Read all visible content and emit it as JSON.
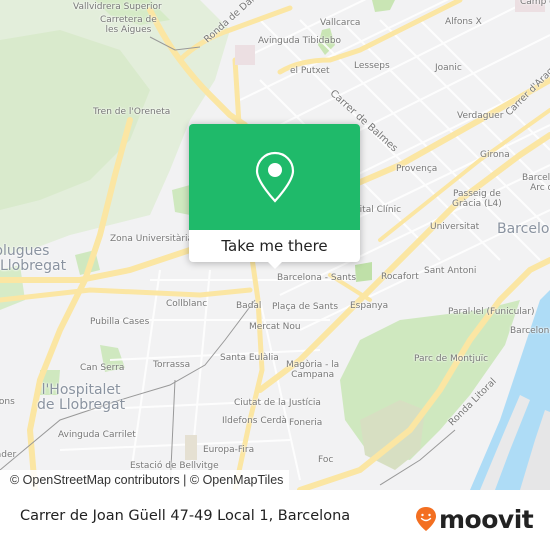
{
  "map": {
    "labels": [
      {
        "id": "vallvidrera-superior",
        "text": "Vallvidrera Superior"
      },
      {
        "id": "carretera-aigues",
        "text": "Carretera de\nles Aigues"
      },
      {
        "id": "ronda-de-dalt",
        "text": "Ronda de Dalt"
      },
      {
        "id": "avinguda-tibidabo",
        "text": "Avinguda Tibidabo"
      },
      {
        "id": "vallcarca",
        "text": "Vallcarca"
      },
      {
        "id": "alfons-x",
        "text": "Alfons X"
      },
      {
        "id": "camp",
        "text": "Camp d"
      },
      {
        "id": "el-putxet",
        "text": "el Putxet"
      },
      {
        "id": "lesseps",
        "text": "Lesseps"
      },
      {
        "id": "joanic",
        "text": "Joanic"
      },
      {
        "id": "carrer-de-balmes",
        "text": "Carrer de Balmes"
      },
      {
        "id": "carrer-arago",
        "text": "Carrer d'Aragó"
      },
      {
        "id": "tren-oreneta",
        "text": "Tren de l'Oreneta"
      },
      {
        "id": "verdaguer",
        "text": "Verdaguer"
      },
      {
        "id": "girona",
        "text": "Girona"
      },
      {
        "id": "provenca",
        "text": "Provença"
      },
      {
        "id": "barcelona-arc",
        "text": "Barcelona\nArc de"
      },
      {
        "id": "passeig-gracia",
        "text": "Passeig de\nGràcia (L4)"
      },
      {
        "id": "hospital-clinic",
        "text": "Hospital Clínic"
      },
      {
        "id": "universitat",
        "text": "Universitat"
      },
      {
        "id": "barcelona",
        "text": "Barcelona"
      },
      {
        "id": "esplugues",
        "text": "Esplugues\nde Llobregat"
      },
      {
        "id": "zona-universitaria",
        "text": "Zona Universitària"
      },
      {
        "id": "barcelona-sants",
        "text": "Barcelona - Sants"
      },
      {
        "id": "rocafort",
        "text": "Rocafort"
      },
      {
        "id": "sant-antoni",
        "text": "Sant Antoni"
      },
      {
        "id": "collblanc",
        "text": "Collblanc"
      },
      {
        "id": "badal",
        "text": "Badal"
      },
      {
        "id": "placa-sants",
        "text": "Plaça de Sants"
      },
      {
        "id": "espanya",
        "text": "Espanya"
      },
      {
        "id": "paralel",
        "text": "Paral·lel (Funicular)"
      },
      {
        "id": "pubilla-cases",
        "text": "Pubilla Cases"
      },
      {
        "id": "mercat-nou",
        "text": "Mercat Nou"
      },
      {
        "id": "barceloneta",
        "text": "Barceloneta"
      },
      {
        "id": "can-serra",
        "text": "Can Serra"
      },
      {
        "id": "torrassa",
        "text": "Torrassa"
      },
      {
        "id": "santa-eulalia",
        "text": "Santa Eulàlia"
      },
      {
        "id": "parc-montjuic",
        "text": "Parc de Montjuïc"
      },
      {
        "id": "magoria",
        "text": "Magòria - la\nCampana"
      },
      {
        "id": "hospitalet",
        "text": "l'Hospitalet\nde Llobregat"
      },
      {
        "id": "fons",
        "text": "Fons"
      },
      {
        "id": "ciutat-justicia",
        "text": "Ciutat de la Justícia"
      },
      {
        "id": "ronda-litoral",
        "text": "Ronda Litoral"
      },
      {
        "id": "avinguda-carrilet",
        "text": "Avinguda Carrilet"
      },
      {
        "id": "ildefons-cerda",
        "text": "Ildefons Cerdà"
      },
      {
        "id": "foneria",
        "text": "Foneria"
      },
      {
        "id": "europa-fira",
        "text": "Europa-Fira"
      },
      {
        "id": "sader",
        "text": "Sader"
      },
      {
        "id": "estacio-bellvitge",
        "text": "Estació de Bellvitge"
      },
      {
        "id": "foc",
        "text": "Foc"
      }
    ],
    "attribution": "© OpenStreetMap contributors | © OpenMapTiles",
    "colors": {
      "land": "#f2f2f3",
      "park": "#cfe8bf",
      "major_road": "#fbe6a3",
      "water": "#aedcf6",
      "popup_green": "#1fba6a"
    }
  },
  "popup": {
    "icon": "map-pin-icon",
    "button_label": "Take me there"
  },
  "footer": {
    "address": "Carrer de Joan Güell 47-49 Local 1, Barcelona",
    "brand": "moovit",
    "brand_icon": "moovit-smiley-pin-icon",
    "brand_color": "#f36f21"
  }
}
